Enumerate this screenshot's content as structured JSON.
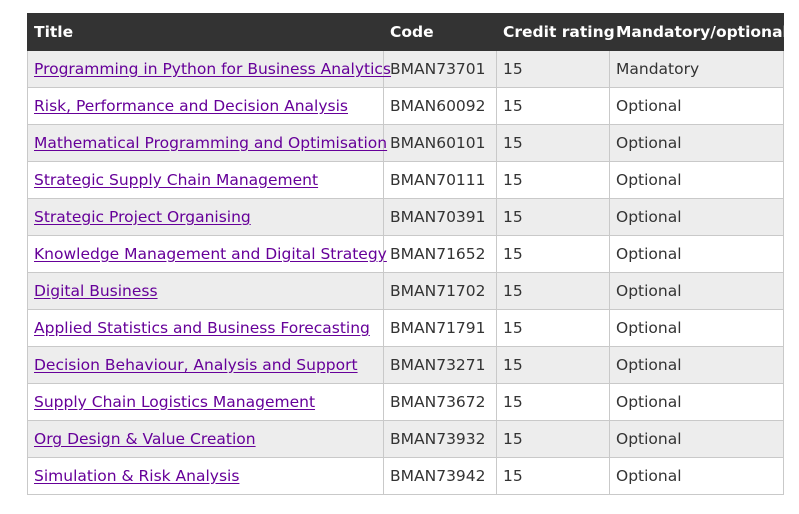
{
  "table": {
    "headers": {
      "title": "Title",
      "code": "Code",
      "credit": "Credit rating",
      "mandatory": "Mandatory/optional"
    },
    "rows": [
      {
        "title": "Programming in Python for Business Analytics",
        "code": "BMAN73701",
        "credit": "15",
        "mandatory": "Mandatory"
      },
      {
        "title": "Risk, Performance and Decision Analysis",
        "code": "BMAN60092",
        "credit": "15",
        "mandatory": "Optional"
      },
      {
        "title": "Mathematical Programming and Optimisation",
        "code": "BMAN60101",
        "credit": "15",
        "mandatory": "Optional"
      },
      {
        "title": "Strategic Supply Chain Management",
        "code": "BMAN70111",
        "credit": "15",
        "mandatory": "Optional"
      },
      {
        "title": "Strategic Project Organising",
        "code": "BMAN70391",
        "credit": "15",
        "mandatory": "Optional"
      },
      {
        "title": "Knowledge Management and Digital Strategy",
        "code": "BMAN71652",
        "credit": "15",
        "mandatory": "Optional"
      },
      {
        "title": "Digital Business",
        "code": "BMAN71702",
        "credit": "15",
        "mandatory": "Optional"
      },
      {
        "title": "Applied Statistics and Business Forecasting",
        "code": "BMAN71791",
        "credit": "15",
        "mandatory": "Optional"
      },
      {
        "title": "Decision Behaviour, Analysis and Support",
        "code": "BMAN73271",
        "credit": "15",
        "mandatory": "Optional"
      },
      {
        "title": "Supply Chain Logistics Management",
        "code": "BMAN73672",
        "credit": "15",
        "mandatory": "Optional"
      },
      {
        "title": "Org Design & Value Creation",
        "code": "BMAN73932",
        "credit": "15",
        "mandatory": "Optional"
      },
      {
        "title": "Simulation & Risk Analysis",
        "code": "BMAN73942",
        "credit": "15",
        "mandatory": "Optional"
      }
    ]
  },
  "colors": {
    "header_bg": "#333333",
    "header_text": "#ffffff",
    "link": "#660099",
    "row_alt": "#ededed",
    "border": "#c9c9c9"
  }
}
